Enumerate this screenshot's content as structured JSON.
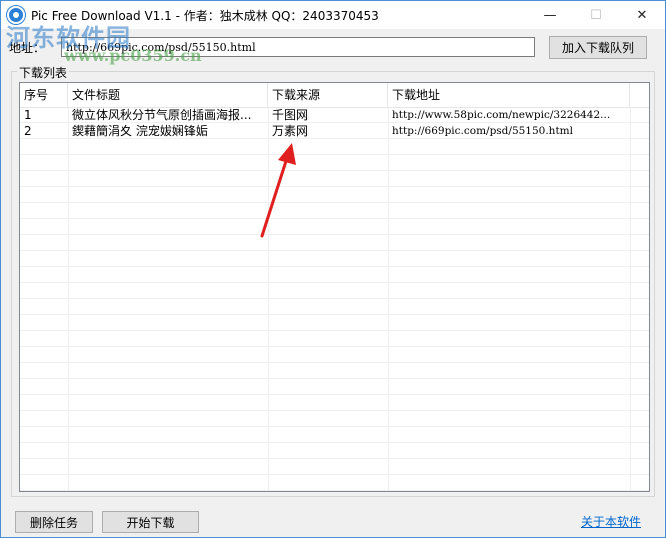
{
  "window": {
    "title": "Pic Free Download V1.1 - 作者：独木成林 QQ：2403370453",
    "minimize": "—",
    "maximize": "☐",
    "close": "✕"
  },
  "watermark": {
    "name": "河东软件园",
    "url": "www.pc0359.cn"
  },
  "address": {
    "label": "地址：",
    "value": "http://669pic.com/psd/55150.html",
    "add_button": "加入下载队列"
  },
  "download_list": {
    "group_label": "下载列表",
    "columns": [
      "序号",
      "文件标题",
      "下载来源",
      "下载地址"
    ],
    "rows": [
      {
        "index": "1",
        "title": "微立体风秋分节气原创插画海报...",
        "source": "千图网",
        "url": "http://www.58pic.com/newpic/3226442..."
      },
      {
        "index": "2",
        "title": "鍥藉簡涓夊  浣宠妭娴锋姤",
        "source": "万素网",
        "url": "http://669pic.com/psd/55150.html"
      }
    ]
  },
  "footer": {
    "delete_button": "删除任务",
    "start_button": "开始下载",
    "about_link": "关于本软件"
  },
  "annotation": {
    "arrow_color": "#e02020"
  }
}
